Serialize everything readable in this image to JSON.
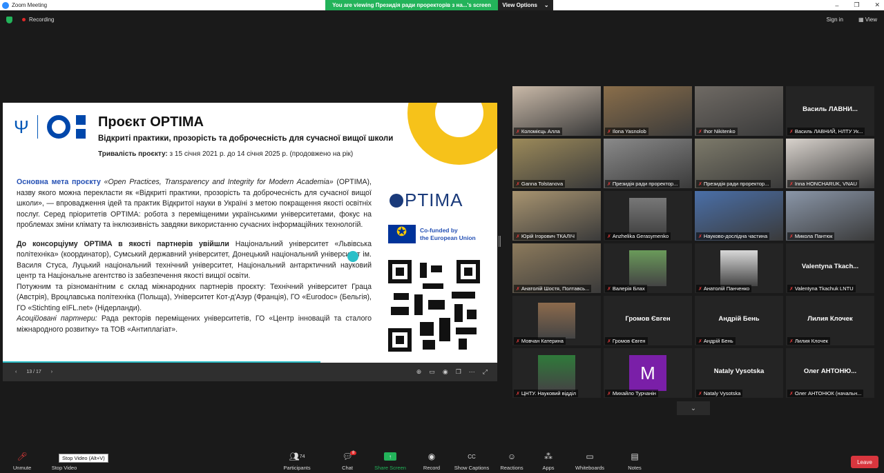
{
  "window": {
    "title": "Zoom Meeting",
    "controls": [
      "–",
      "❐",
      "✕"
    ]
  },
  "banner": {
    "message": "You are viewing Президія ради проректорів з на...'s screen",
    "view_options": "View Options"
  },
  "topbar": {
    "recording": "Recording",
    "sign_in": "Sign in",
    "view": "View"
  },
  "slide": {
    "title": "Проєкт OPTIMA",
    "subtitle": "Відкриті практики, прозорість та доброчесність для сучасної вищої школи",
    "duration_label": "Тривалість проєкту:",
    "duration_value": " з 15 січня 2021 р. до 14 січня 2025 р. (продовжено на рік)",
    "main_goal_label": "Основна мета проєкту",
    "main_goal_italic": " «Open Practices, Transparency and Integrity for Modern Academia»",
    "main_goal_text": " (OPTIMA), назву якого можна перекласти як «Відкриті практики, прозорість та доброчесність для сучасної вищої школи», — впровадження ідей та практик Відкритої науки в Україні з метою покращення якості освітніх послуг. Серед пріоритетів OPTIMA: робота з переміщеними українськими університетами, фокус на проблемах зміни клімату та інклюзивність завдяки використанню сучасних інформаційних технологій.",
    "consortium_label": "До консорціуму OPTIMA в якості партнерів увійшли",
    "consortium_text": " Національний університет «Львівська політехніка» (координатор), Сумський державний університет, Донецький національний університет ім. Василя Стуса, Луцький національний технічний університет, Національний антарктичний науковий центр та Національне агентство із забезпечення якості вищої освіти.",
    "intl_text": "Потужним та різноманітним є склад міжнародних партнерів проєкту: Технічний університет Граца (Австрія), Вроцлавська політехніка (Польща), Університет Кот-д'Азур (Франція), ГО «Eurodoc» (Бельгія), ГО «Stichting eIFL.net» (Нідерланди).",
    "assoc_label": "Асоційовані партнери:",
    "assoc_text": " Рада ректорів переміщених університетів, ГО «Центр інновацій та сталого міжнародного розвитку» та ТОВ «Антиплагіат».",
    "optima_logo": "PTIMA",
    "eu_line1": "Co-funded by",
    "eu_line2": "the European Union",
    "page_indicator": "13 / 17"
  },
  "participants": [
    {
      "name": "Коломієць Алла",
      "type": "video",
      "bg": "#c9b9a8"
    },
    {
      "name": "Ilona Yasnolob",
      "type": "video",
      "bg": "#8a6e4a"
    },
    {
      "name": "Ihor Nikitenko",
      "type": "video",
      "bg": "#6f6a64"
    },
    {
      "name": "Василь ЛАВНИЙ, НЛТУ Ук...",
      "type": "name",
      "big": "Василь  ЛАВНИ..."
    },
    {
      "name": "Ganna Tolstanova",
      "type": "video",
      "bg": "#9c8a5a",
      "active": true
    },
    {
      "name": "Президія ради проректор...",
      "type": "video",
      "bg": "#8a8a8a"
    },
    {
      "name": "Президія ради проректор...",
      "type": "video",
      "bg": "#7d7a6a"
    },
    {
      "name": "Inna HONCHARUK, VNAU",
      "type": "video",
      "bg": "#d8d2cc"
    },
    {
      "name": "Юрій Ігорович ТКАЛІЧ",
      "type": "video",
      "bg": "#a89470"
    },
    {
      "name": "Anzhelika Gerasymenko",
      "type": "photo",
      "bg": "#777"
    },
    {
      "name": "Науково-дослідна частина",
      "type": "video",
      "bg": "#4a6fa8"
    },
    {
      "name": "Микола Пантюк",
      "type": "video",
      "bg": "#8a96a8"
    },
    {
      "name": "Анатолій Шостя, Полтавсь...",
      "type": "video",
      "bg": "#8c7a5c"
    },
    {
      "name": "Валерія Блах",
      "type": "photo",
      "bg": "#6a9a5a"
    },
    {
      "name": "Анатолій Панченко",
      "type": "photo",
      "bg": "#d8d8d8"
    },
    {
      "name": "Valentyna Tkachuk LNTU",
      "type": "name",
      "big": "Valentyna  Tkach..."
    },
    {
      "name": "Мовчан Катерина",
      "type": "photo",
      "bg": "#8c6a4c"
    },
    {
      "name": "Громов Євген",
      "type": "name",
      "big": "Громов Євген"
    },
    {
      "name": "Андрій Бень",
      "type": "name",
      "big": "Андрій Бень"
    },
    {
      "name": "Лилия Клочек",
      "type": "name",
      "big": "Лилия Клочек"
    },
    {
      "name": "ЦНТУ. Науковий відділ",
      "type": "photo",
      "bg": "#2f7a3a"
    },
    {
      "name": "Михайло Турчанін",
      "type": "letter",
      "letter": "M",
      "bg": "#7a1fa8"
    },
    {
      "name": "Nataly Vysotska",
      "type": "name",
      "big": "Nataly Vysotska"
    },
    {
      "name": "Олег АНТОНЮК (начальн...",
      "type": "name",
      "big": "Олег  АНТОНЮ..."
    }
  ],
  "toolbar": {
    "unmute": "Unmute",
    "stop_video": "Stop Video",
    "tooltip": "Stop Video (Alt+V)",
    "participants": "Participants",
    "participants_count": "74",
    "chat": "Chat",
    "chat_badge": "8",
    "share": "Share Screen",
    "record": "Record",
    "captions": "Show Captions",
    "reactions": "Reactions",
    "apps": "Apps",
    "whiteboards": "Whiteboards",
    "notes": "Notes",
    "leave": "Leave"
  }
}
